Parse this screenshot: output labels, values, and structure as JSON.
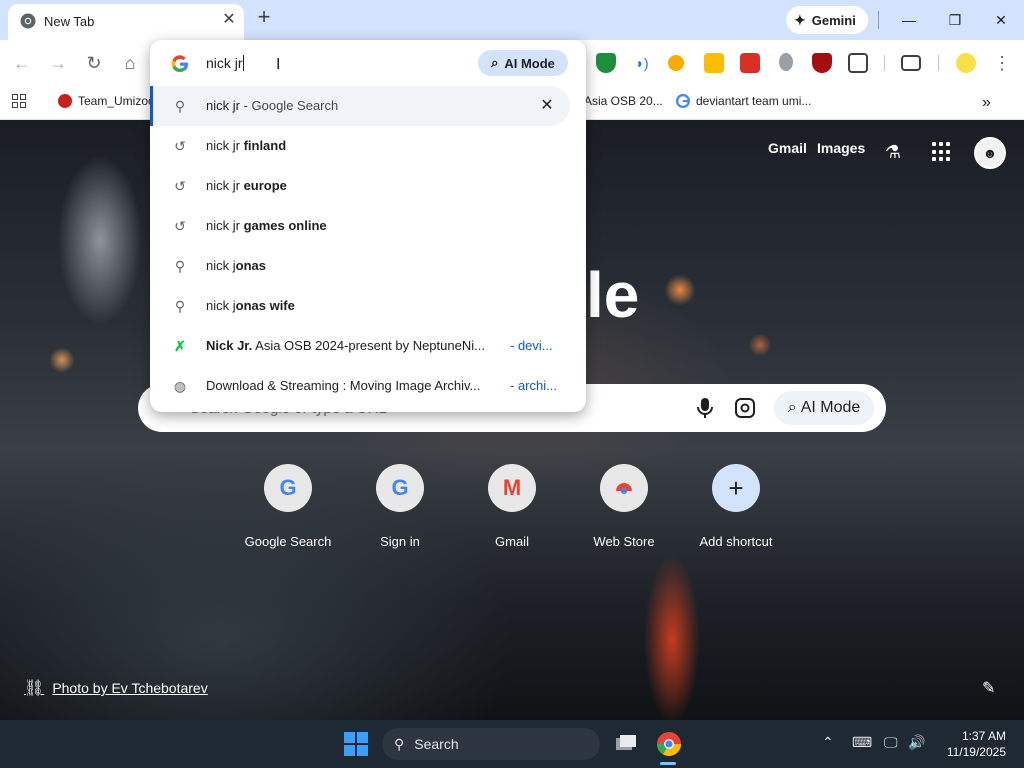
{
  "browser": {
    "tab": {
      "title": "New Tab"
    },
    "gemini_label": "Gemini",
    "bookmarks": [
      {
        "label": "Team_Umizoo"
      },
      {
        "label": "Asia OSB 20..."
      },
      {
        "label": "deviantart team umi..."
      }
    ]
  },
  "omnibox": {
    "query": "nick jr",
    "ai_mode_label": "AI Mode",
    "suggestions": [
      {
        "icon": "search-icon",
        "plain": "nick jr",
        "dim": " - Google Search",
        "bold": "",
        "source": ""
      },
      {
        "icon": "history-icon",
        "plain": "nick jr ",
        "bold": "finland",
        "dim": "",
        "source": ""
      },
      {
        "icon": "history-icon",
        "plain": "nick jr ",
        "bold": "europe",
        "dim": "",
        "source": ""
      },
      {
        "icon": "history-icon",
        "plain": "nick jr ",
        "bold": "games online",
        "dim": "",
        "source": ""
      },
      {
        "icon": "search-icon",
        "plain": "nick j",
        "bold": "onas",
        "dim": "",
        "source": ""
      },
      {
        "icon": "search-icon",
        "plain": "nick j",
        "bold": "onas wife",
        "dim": "",
        "source": ""
      },
      {
        "icon": "deviantart-icon",
        "bold_first": "Nick Jr.",
        "plain": " Asia OSB 2024-present by NeptuneNi...",
        "source": "- devi..."
      },
      {
        "icon": "globe-icon",
        "plain": "Download & Streaming : Moving Image Archiv...",
        "source": "- archi..."
      }
    ]
  },
  "ntp": {
    "links": {
      "gmail": "Gmail",
      "images": "Images"
    },
    "logo_fragment": "le",
    "search_placeholder": "Search Google or type a URL",
    "ai_mode_label": "AI Mode",
    "shortcuts": [
      {
        "label": "Google Search"
      },
      {
        "label": "Sign in"
      },
      {
        "label": "Gmail"
      },
      {
        "label": "Web Store"
      },
      {
        "label": "Add shortcut"
      }
    ],
    "photo_credit": "Photo by Ev Tchebotarev"
  },
  "taskbar": {
    "search_label": "Search",
    "time": "1:37 AM",
    "date": "11/19/2025"
  },
  "colors": {
    "accent": "#0b57d0",
    "tabstrip": "#d3e3fd",
    "taskbar": "#1f2933"
  }
}
